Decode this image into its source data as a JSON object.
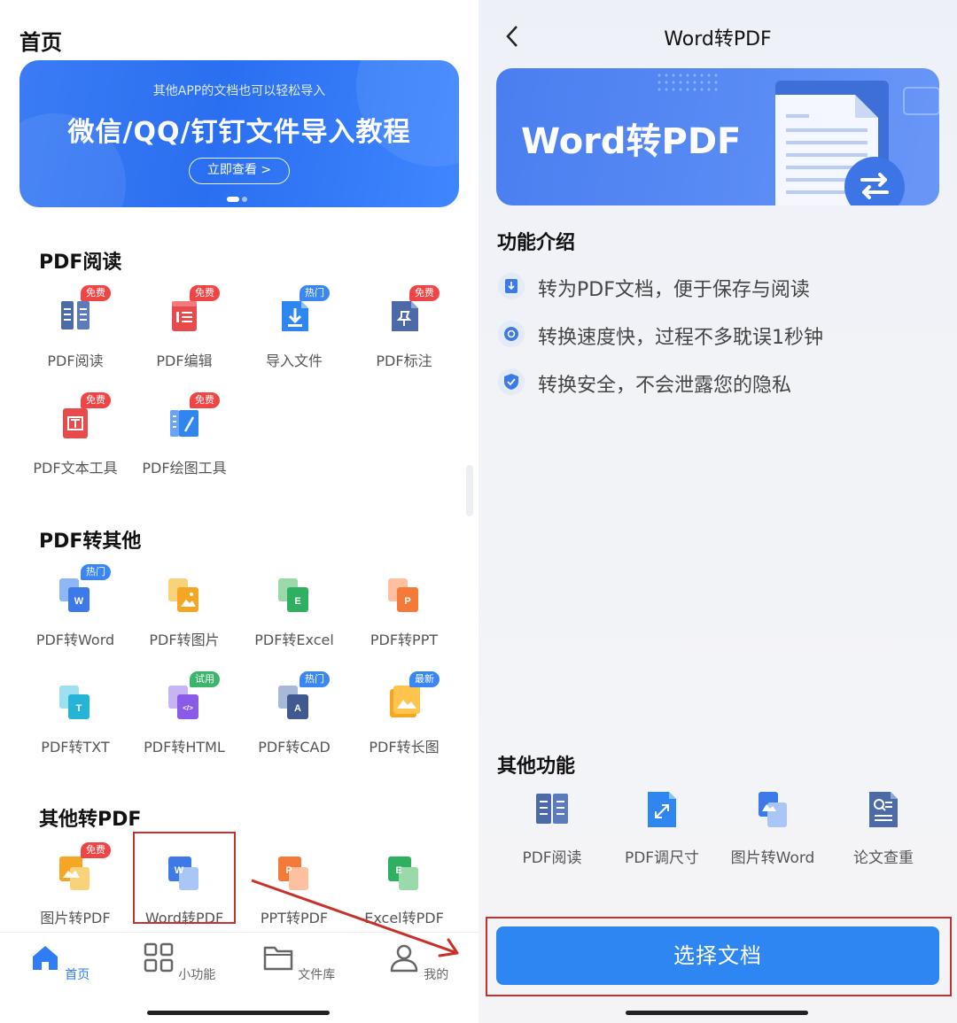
{
  "left": {
    "home_title": "首页",
    "banner": {
      "subtitle": "其他APP的文档也可以轻松导入",
      "title": "微信/QQ/钉钉文件导入教程",
      "button": "立即查看 >"
    },
    "sections": {
      "pdf_read": {
        "title": "PDF阅读",
        "items": [
          {
            "label": "PDF阅读",
            "badge": "免费",
            "icon": "book-icon"
          },
          {
            "label": "PDF编辑",
            "badge": "免费",
            "icon": "edit-doc-icon"
          },
          {
            "label": "导入文件",
            "badge": "热门",
            "icon": "import-icon"
          },
          {
            "label": "PDF标注",
            "badge": "免费",
            "icon": "pin-icon"
          },
          {
            "label": "PDF文本工具",
            "badge": "免费",
            "icon": "text-tool-icon"
          },
          {
            "label": "PDF绘图工具",
            "badge": "免费",
            "icon": "draw-tool-icon"
          }
        ]
      },
      "pdf_to_other": {
        "title": "PDF转其他",
        "items": [
          {
            "label": "PDF转Word",
            "badge": "热门",
            "icon": "word-icon"
          },
          {
            "label": "PDF转图片",
            "badge": "",
            "icon": "image-icon"
          },
          {
            "label": "PDF转Excel",
            "badge": "",
            "icon": "excel-icon"
          },
          {
            "label": "PDF转PPT",
            "badge": "",
            "icon": "ppt-icon"
          },
          {
            "label": "PDF转TXT",
            "badge": "",
            "icon": "txt-icon"
          },
          {
            "label": "PDF转HTML",
            "badge": "试用",
            "icon": "html-icon"
          },
          {
            "label": "PDF转CAD",
            "badge": "热门",
            "icon": "cad-icon"
          },
          {
            "label": "PDF转长图",
            "badge": "最新",
            "icon": "long-image-icon"
          }
        ]
      },
      "other_to_pdf": {
        "title": "其他转PDF",
        "items": [
          {
            "label": "图片转PDF",
            "badge": "免费",
            "icon": "image-icon"
          },
          {
            "label": "Word转PDF",
            "badge": "",
            "icon": "word-icon"
          },
          {
            "label": "PPT转PDF",
            "badge": "",
            "icon": "ppt-icon"
          },
          {
            "label": "Excel转PDF",
            "badge": "",
            "icon": "excel-icon"
          }
        ]
      }
    },
    "tabbar": [
      {
        "label": "首页",
        "icon": "home-icon",
        "active": true
      },
      {
        "label": "小功能",
        "icon": "grid-icon",
        "active": false
      },
      {
        "label": "文件库",
        "icon": "folder-icon",
        "active": false
      },
      {
        "label": "我的",
        "icon": "user-icon",
        "active": false
      }
    ]
  },
  "right": {
    "title": "Word转PDF",
    "hero_title": "Word转PDF",
    "intro_title": "功能介绍",
    "features": [
      "转为PDF文档，便于保存与阅读",
      "转换速度快，过程不多耽误1秒钟",
      "转换安全，不会泄露您的隐私"
    ],
    "other_title": "其他功能",
    "other_items": [
      {
        "label": "PDF阅读",
        "icon": "book-icon"
      },
      {
        "label": "PDF调尺寸",
        "icon": "resize-icon"
      },
      {
        "label": "图片转Word",
        "icon": "image-word-icon"
      },
      {
        "label": "论文查重",
        "icon": "search-doc-icon"
      }
    ],
    "select_button": "选择文档"
  },
  "colors": {
    "accent": "#2e7cf6",
    "badge_red": "#f04545",
    "badge_blue": "#3a86f5",
    "badge_green": "#3bb56b",
    "highlight": "#c8302a"
  }
}
